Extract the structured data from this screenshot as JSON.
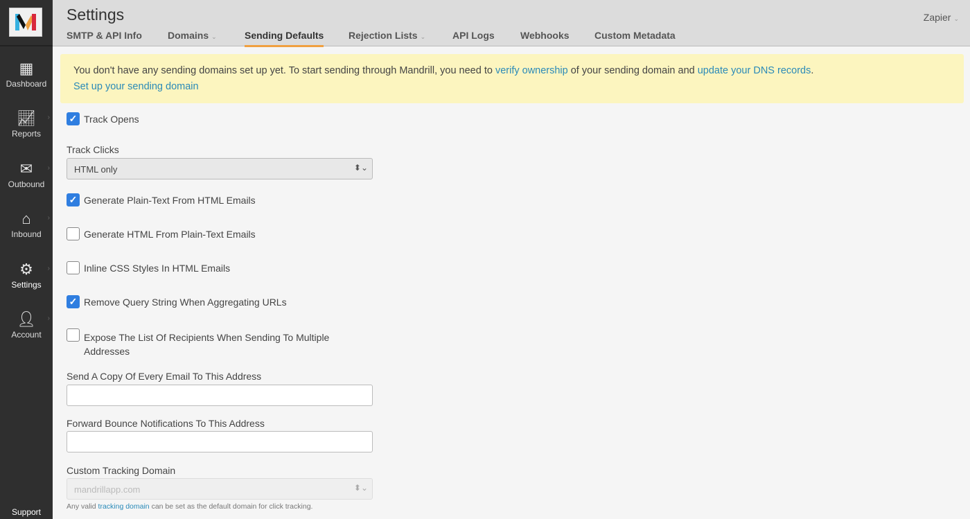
{
  "sidebar": {
    "items": [
      {
        "label": "Dashboard",
        "icon": "grid-icon"
      },
      {
        "label": "Reports",
        "icon": "chart-icon"
      },
      {
        "label": "Outbound",
        "icon": "envelope-icon"
      },
      {
        "label": "Inbound",
        "icon": "inbox-icon"
      },
      {
        "label": "Settings",
        "icon": "gear-icon"
      },
      {
        "label": "Account",
        "icon": "user-icon"
      }
    ],
    "support": "Support"
  },
  "header": {
    "title": "Settings",
    "user": "Zapier",
    "tabs": [
      "SMTP & API Info",
      "Domains",
      "Sending Defaults",
      "Rejection Lists",
      "API Logs",
      "Webhooks",
      "Custom Metadata"
    ]
  },
  "alert": {
    "text1": "You don't have any sending domains set up yet. To start sending through Mandrill, you need to ",
    "link1": "verify ownership",
    "text2": " of your sending domain and ",
    "link2": "update your DNS records",
    "text3": ".",
    "link3": "Set up your sending domain"
  },
  "form": {
    "track_opens": "Track Opens",
    "track_clicks_label": "Track Clicks",
    "track_clicks_value": "HTML only",
    "gen_plain": "Generate Plain-Text From HTML Emails",
    "gen_html": "Generate HTML From Plain-Text Emails",
    "inline_css": "Inline CSS Styles In HTML Emails",
    "remove_query": "Remove Query String When Aggregating URLs",
    "expose_list": "Expose The List Of Recipients When Sending To Multiple Addresses",
    "copy_label": "Send A Copy Of Every Email To This Address",
    "copy_value": "",
    "bounce_label": "Forward Bounce Notifications To This Address",
    "bounce_value": "",
    "tracking_label": "Custom Tracking Domain",
    "tracking_value": "mandrillapp.com",
    "help1": "Any valid ",
    "help_link": "tracking domain",
    "help2": " can be set as the default domain for click tracking.",
    "check": "✓"
  }
}
